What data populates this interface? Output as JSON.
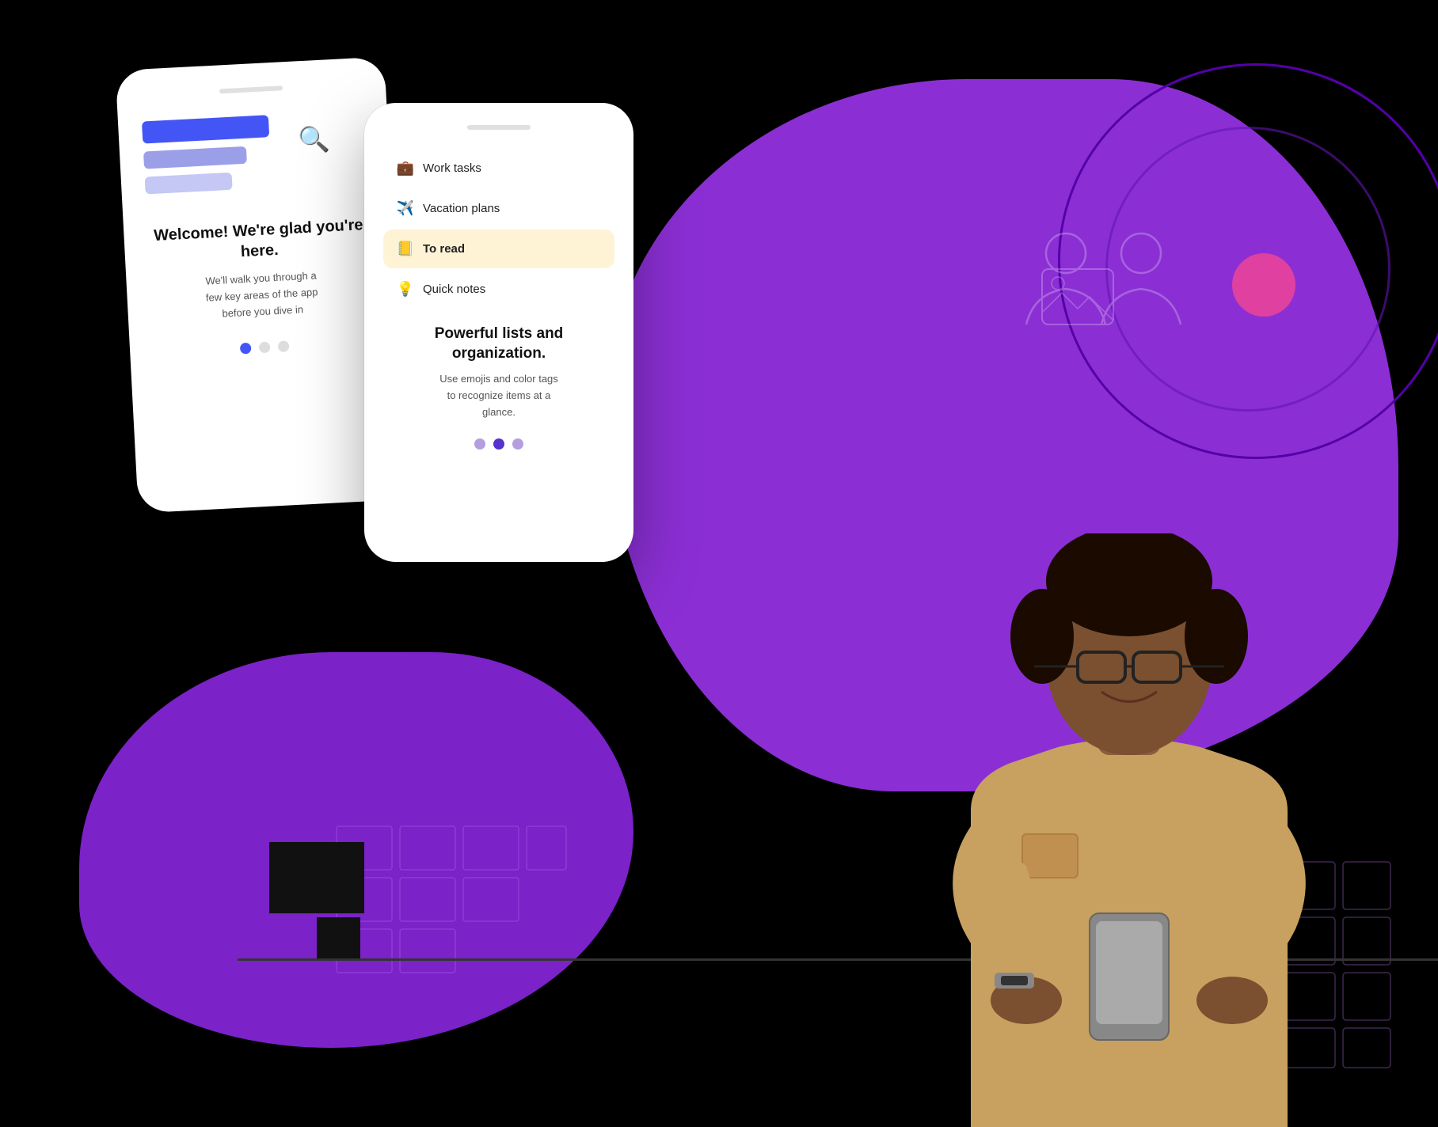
{
  "scene": {
    "background": "#000000"
  },
  "phone_left": {
    "notch_visible": true,
    "welcome_title": "Welcome!\nWe're glad you're here.",
    "welcome_subtitle": "We'll walk you through a\nfew key areas of the app\nbefore you dive in",
    "dots": [
      "active",
      "inactive",
      "inactive"
    ]
  },
  "phone_right": {
    "notch_visible": true,
    "list_items": [
      {
        "emoji": "💼",
        "label": "Work tasks",
        "highlighted": false
      },
      {
        "emoji": "✈️",
        "label": "Vacation plans",
        "highlighted": false
      },
      {
        "emoji": "📒",
        "label": "To read",
        "highlighted": true
      },
      {
        "emoji": "💡",
        "label": "Quick notes",
        "highlighted": false
      }
    ],
    "promo_title": "Powerful lists and\norganization.",
    "promo_subtitle": "Use emojis and color tags\nto recognize items at a\nglance.",
    "dots": [
      "inactive",
      "active",
      "inactive"
    ]
  },
  "colors": {
    "purple_blob": "#8B2FD4",
    "purple_dark": "#7000BB",
    "pink_accent": "#E040A0",
    "blue_primary": "#4355F5",
    "highlight_yellow": "#FFF3D6",
    "black": "#000000",
    "white": "#FFFFFF"
  }
}
